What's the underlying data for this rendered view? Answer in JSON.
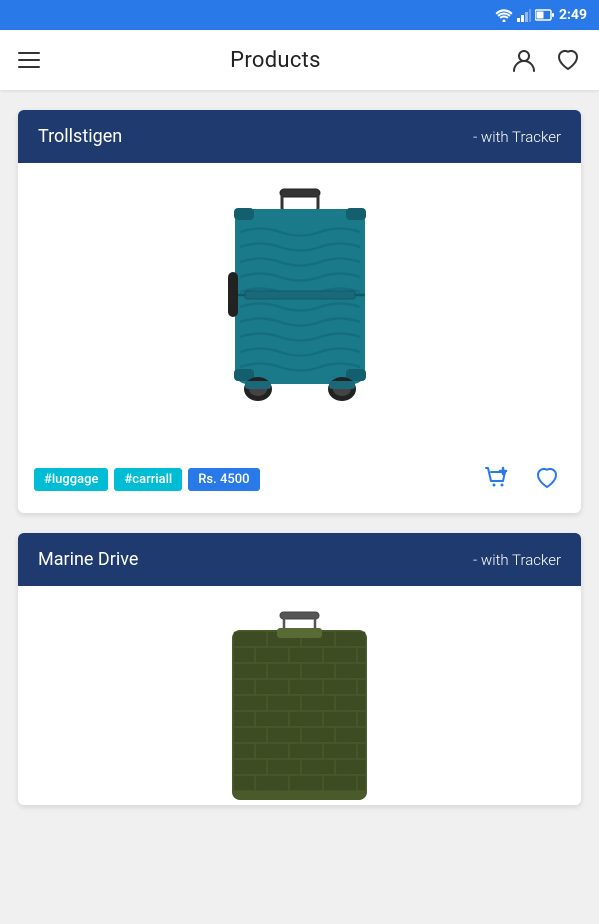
{
  "statusBar": {
    "time": "2:49",
    "icons": [
      "wifi",
      "signal",
      "battery"
    ]
  },
  "header": {
    "title": "Products",
    "menuIcon": "hamburger-icon",
    "profileIcon": "person-icon",
    "wishlistIcon": "heart-icon"
  },
  "products": [
    {
      "id": "trollstigen",
      "name": "Trollstigen",
      "subtitle": "- with Tracker",
      "tags": [
        "#luggage",
        "#carriall"
      ],
      "price": "Rs. 4500",
      "imageType": "teal-suitcase"
    },
    {
      "id": "marine-drive",
      "name": "Marine Drive",
      "subtitle": "- with Tracker",
      "tags": [],
      "price": "",
      "imageType": "green-suitcase"
    }
  ],
  "tagColors": {
    "luggage": "#00bcd4",
    "carriall": "#00bcd4",
    "price": "#2979e8"
  }
}
